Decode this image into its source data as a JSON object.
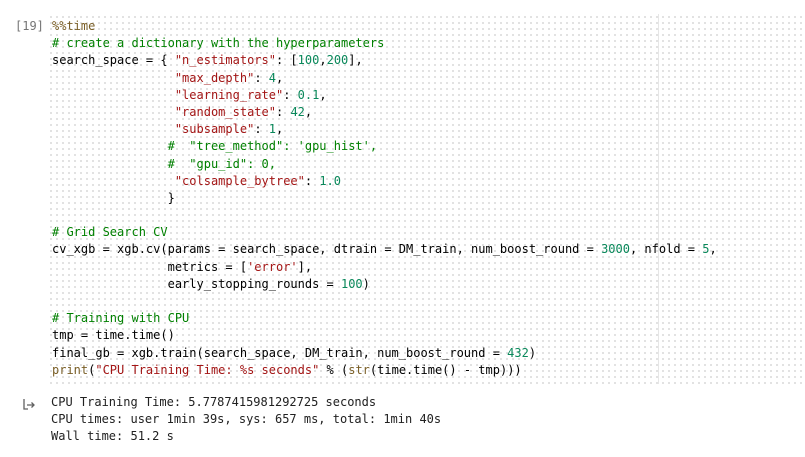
{
  "cell": {
    "execution_count": "[19]",
    "lines": [
      [
        {
          "t": "%%time",
          "k": "m"
        }
      ],
      [
        {
          "t": "# create a dictionary with the hyperparameters",
          "k": "c"
        }
      ],
      [
        {
          "t": "search_space = { ",
          "k": ""
        },
        {
          "t": "\"n_estimators\"",
          "k": "s"
        },
        {
          "t": ": [",
          "k": ""
        },
        {
          "t": "100",
          "k": "n"
        },
        {
          "t": ",",
          "k": ""
        },
        {
          "t": "200",
          "k": "n"
        },
        {
          "t": "],",
          "k": ""
        }
      ],
      [
        {
          "t": "                 ",
          "k": ""
        },
        {
          "t": "\"max_depth\"",
          "k": "s"
        },
        {
          "t": ": ",
          "k": ""
        },
        {
          "t": "4",
          "k": "n"
        },
        {
          "t": ",",
          "k": ""
        }
      ],
      [
        {
          "t": "                 ",
          "k": ""
        },
        {
          "t": "\"learning_rate\"",
          "k": "s"
        },
        {
          "t": ": ",
          "k": ""
        },
        {
          "t": "0.1",
          "k": "n"
        },
        {
          "t": ",",
          "k": ""
        }
      ],
      [
        {
          "t": "                 ",
          "k": ""
        },
        {
          "t": "\"random_state\"",
          "k": "s"
        },
        {
          "t": ": ",
          "k": ""
        },
        {
          "t": "42",
          "k": "n"
        },
        {
          "t": ",",
          "k": ""
        }
      ],
      [
        {
          "t": "                 ",
          "k": ""
        },
        {
          "t": "\"subsample\"",
          "k": "s"
        },
        {
          "t": ": ",
          "k": ""
        },
        {
          "t": "1",
          "k": "n"
        },
        {
          "t": ",",
          "k": ""
        }
      ],
      [
        {
          "t": "                ",
          "k": ""
        },
        {
          "t": "#  \"tree_method\": 'gpu_hist',",
          "k": "c"
        }
      ],
      [
        {
          "t": "                ",
          "k": ""
        },
        {
          "t": "#  \"gpu_id\": 0,",
          "k": "c"
        }
      ],
      [
        {
          "t": "                 ",
          "k": ""
        },
        {
          "t": "\"colsample_bytree\"",
          "k": "s"
        },
        {
          "t": ": ",
          "k": ""
        },
        {
          "t": "1.0",
          "k": "n"
        }
      ],
      [
        {
          "t": "                }",
          "k": ""
        }
      ],
      [
        {
          "t": "",
          "k": ""
        }
      ],
      [
        {
          "t": "# Grid Search CV",
          "k": "c"
        }
      ],
      [
        {
          "t": "cv_xgb = xgb.cv(params = search_space, dtrain = DM_train, num_boost_round = ",
          "k": ""
        },
        {
          "t": "3000",
          "k": "n"
        },
        {
          "t": ", nfold = ",
          "k": ""
        },
        {
          "t": "5",
          "k": "n"
        },
        {
          "t": ",",
          "k": ""
        }
      ],
      [
        {
          "t": "                metrics = [",
          "k": ""
        },
        {
          "t": "'error'",
          "k": "s"
        },
        {
          "t": "],",
          "k": ""
        }
      ],
      [
        {
          "t": "                early_stopping_rounds = ",
          "k": ""
        },
        {
          "t": "100",
          "k": "n"
        },
        {
          "t": ")",
          "k": ""
        }
      ],
      [
        {
          "t": "",
          "k": ""
        }
      ],
      [
        {
          "t": "# Training with CPU",
          "k": "c"
        }
      ],
      [
        {
          "t": "tmp = time.time()",
          "k": ""
        }
      ],
      [
        {
          "t": "final_gb = xgb.train(search_space, DM_train, num_boost_round = ",
          "k": ""
        },
        {
          "t": "432",
          "k": "n"
        },
        {
          "t": ")",
          "k": ""
        }
      ],
      [
        {
          "t": "print",
          "k": "b"
        },
        {
          "t": "(",
          "k": ""
        },
        {
          "t": "\"CPU Training Time: %s seconds\"",
          "k": "s"
        },
        {
          "t": " % (",
          "k": ""
        },
        {
          "t": "str",
          "k": "b"
        },
        {
          "t": "(time.time() - tmp)))",
          "k": ""
        }
      ]
    ]
  },
  "output": {
    "icon": "output-redirect-icon",
    "lines": [
      "CPU Training Time: 5.7787415981292725 seconds",
      "CPU times: user 1min 39s, sys: 657 ms, total: 1min 40s",
      "Wall time: 51.2 s"
    ]
  },
  "colors": {
    "comment": "#008000",
    "string": "#a31515",
    "number": "#09885a",
    "builtin": "#795e26"
  }
}
